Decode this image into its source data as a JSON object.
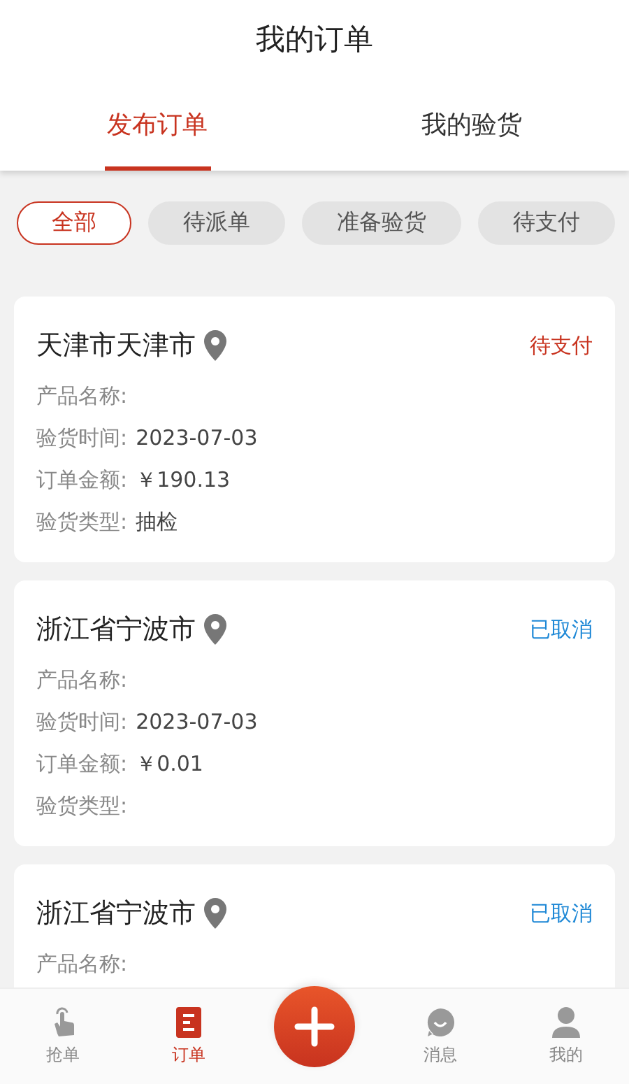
{
  "header": {
    "title": "我的订单"
  },
  "tabs": [
    {
      "label": "发布订单",
      "selected": true
    },
    {
      "label": "我的验货",
      "selected": false
    }
  ],
  "filters": [
    {
      "label": "全部",
      "selected": true
    },
    {
      "label": "待派单",
      "selected": false
    },
    {
      "label": "准备验货",
      "selected": false
    },
    {
      "label": "待支付",
      "selected": false
    }
  ],
  "orders": [
    {
      "location": "天津市天津市",
      "status": {
        "text": "待支付",
        "color": "#c8331f"
      },
      "fields": [
        {
          "label": "产品名称:"
        },
        {
          "label": "验货时间:",
          "value": "2023-07-03"
        },
        {
          "label": "订单金额:",
          "value": "￥190.13"
        },
        {
          "label": "验货类型:",
          "value": "抽检"
        }
      ]
    },
    {
      "location": "浙江省宁波市",
      "status": {
        "text": "已取消",
        "color": "#1e88d6"
      },
      "fields": [
        {
          "label": "产品名称:"
        },
        {
          "label": "验货时间:",
          "value": "2023-07-03"
        },
        {
          "label": "订单金额:",
          "value": "￥0.01"
        },
        {
          "label": "验货类型:"
        }
      ]
    },
    {
      "location": "浙江省宁波市",
      "status": {
        "text": "已取消",
        "color": "#1e88d6"
      },
      "fields": [
        {
          "label": "产品名称:"
        }
      ]
    }
  ],
  "nav": [
    {
      "kind": "grab",
      "label": "抢单",
      "selected": false
    },
    {
      "kind": "orders",
      "label": "订单",
      "selected": true
    },
    {
      "kind": "add"
    },
    {
      "kind": "messages",
      "label": "消息",
      "selected": false
    },
    {
      "kind": "profile",
      "label": "我的",
      "selected": false
    }
  ]
}
